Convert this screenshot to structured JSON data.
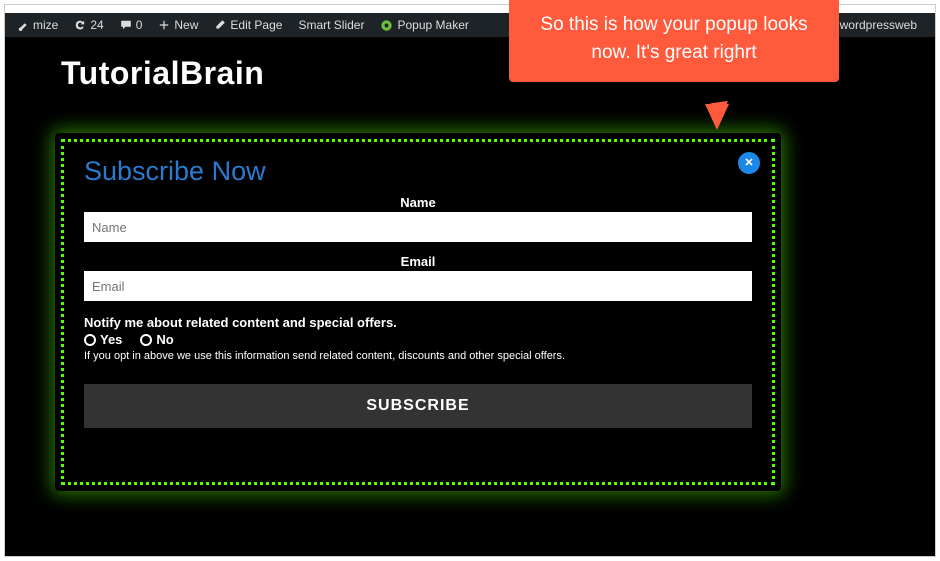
{
  "adminbar": {
    "customize_fragment": "mize",
    "updates_count": "24",
    "comments_count": "0",
    "new_label": "New",
    "edit_label": "Edit Page",
    "smart_slider_label": "Smart Slider",
    "popup_maker_label": "Popup Maker",
    "howdy_label": "wdy, wordpressweb"
  },
  "brand": "TutorialBrain",
  "callout_text": "So this is how your popup looks now. It's great righrt",
  "popup": {
    "title": "Subscribe Now",
    "name_label": "Name",
    "name_placeholder": "Name",
    "email_label": "Email",
    "email_placeholder": "Email",
    "notify_title": "Notify me about related content and special offers.",
    "option_yes": "Yes",
    "option_no": "No",
    "fine_print": "If you opt in above we use this information send related content, discounts and other special offers.",
    "subscribe_label": "SUBSCRIBE"
  }
}
